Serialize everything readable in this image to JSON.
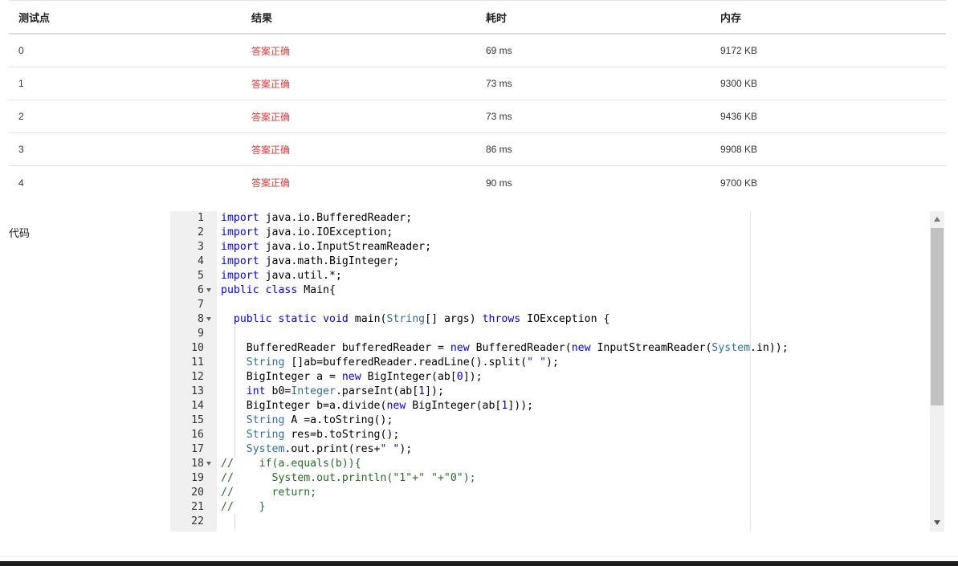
{
  "table": {
    "headers": [
      "测试点",
      "结果",
      "耗时",
      "内存"
    ],
    "rows": [
      {
        "id": "0",
        "result": "答案正确",
        "time": "69 ms",
        "memory": "9172 KB"
      },
      {
        "id": "1",
        "result": "答案正确",
        "time": "73 ms",
        "memory": "9300 KB"
      },
      {
        "id": "2",
        "result": "答案正确",
        "time": "73 ms",
        "memory": "9436 KB"
      },
      {
        "id": "3",
        "result": "答案正确",
        "time": "86 ms",
        "memory": "9908 KB"
      },
      {
        "id": "4",
        "result": "答案正确",
        "time": "90 ms",
        "memory": "9700 KB"
      }
    ]
  },
  "code": {
    "label": "代码",
    "lines": [
      {
        "n": "1",
        "text": "import java.io.BufferedReader;"
      },
      {
        "n": "2",
        "text": "import java.io.IOException;"
      },
      {
        "n": "3",
        "text": "import java.io.InputStreamReader;"
      },
      {
        "n": "4",
        "text": "import java.math.BigInteger;"
      },
      {
        "n": "5",
        "text": "import java.util.*;"
      },
      {
        "n": "6",
        "text": "public class Main{",
        "fold": true
      },
      {
        "n": "7",
        "text": ""
      },
      {
        "n": "8",
        "text": "  public static void main(String[] args) throws IOException {",
        "fold": true
      },
      {
        "n": "9",
        "text": ""
      },
      {
        "n": "10",
        "text": "    BufferedReader bufferedReader = new BufferedReader(new InputStreamReader(System.in));"
      },
      {
        "n": "11",
        "text": "    String []ab=bufferedReader.readLine().split(\" \");"
      },
      {
        "n": "12",
        "text": "    BigInteger a = new BigInteger(ab[0]);"
      },
      {
        "n": "13",
        "text": "    int b0=Integer.parseInt(ab[1]);"
      },
      {
        "n": "14",
        "text": "    BigInteger b=a.divide(new BigInteger(ab[1]));"
      },
      {
        "n": "15",
        "text": "    String A =a.toString();"
      },
      {
        "n": "16",
        "text": "    String res=b.toString();"
      },
      {
        "n": "17",
        "text": "    System.out.print(res+\" \");"
      },
      {
        "n": "18",
        "text": "//    if(a.equals(b)){",
        "fold": true
      },
      {
        "n": "19",
        "text": "//      System.out.println(\"1\"+\" \"+\"0\");"
      },
      {
        "n": "20",
        "text": "//      return;"
      },
      {
        "n": "21",
        "text": "//    }"
      },
      {
        "n": "22",
        "text": ""
      }
    ]
  },
  "colors": {
    "success": "#e4393c",
    "keyword": "#0000ff",
    "comment": "#236e24"
  }
}
